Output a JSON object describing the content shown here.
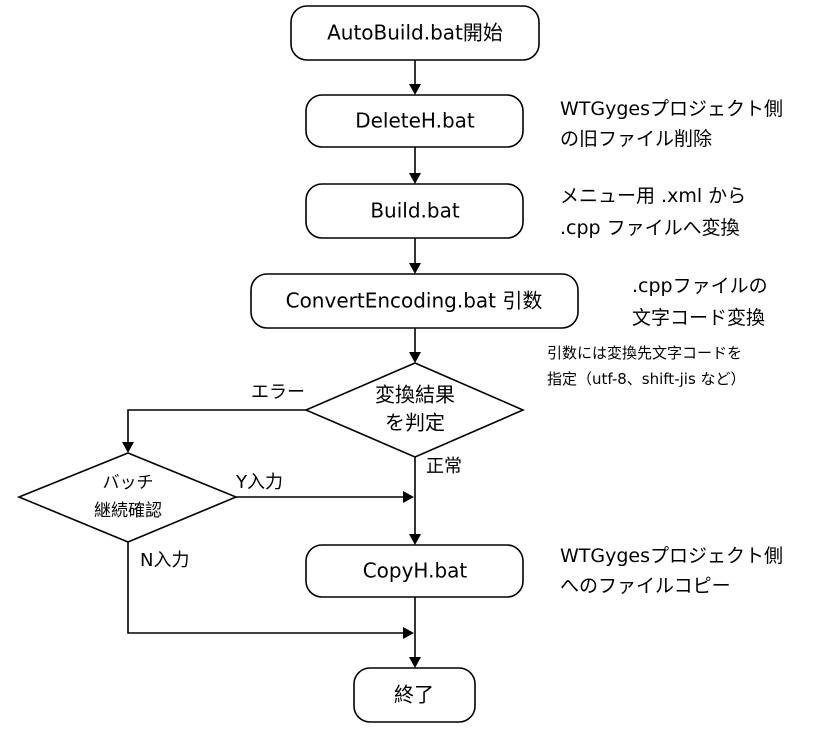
{
  "nodes": {
    "start": "AutoBuild.bat開始",
    "delete": "DeleteH.bat",
    "build": "Build.bat",
    "convert": "ConvertEncoding.bat 引数",
    "decision_line1": "変換結果",
    "decision_line2": "を判定",
    "batch_line1": "バッチ",
    "batch_line2": "継続確認",
    "copy": "CopyH.bat",
    "end": "終了"
  },
  "notes": {
    "delete_line1": "WTGygesプロジェクト側",
    "delete_line2": "の旧ファイル削除",
    "build_line1": "メニュー用 .xml から",
    "build_line2": ".cpp ファイルへ変換",
    "convert_line1": ".cppファイルの",
    "convert_line2": "文字コード変換",
    "arg_line1": "引数には変換先文字コードを",
    "arg_line2": "指定（utf-8、shift-jis など）",
    "copy_line1": "WTGygesプロジェクト側",
    "copy_line2": "へのファイルコピー"
  },
  "labels": {
    "error": "エラー",
    "normal": "正常",
    "yes_input": "Y入力",
    "no_input": "N入力"
  }
}
